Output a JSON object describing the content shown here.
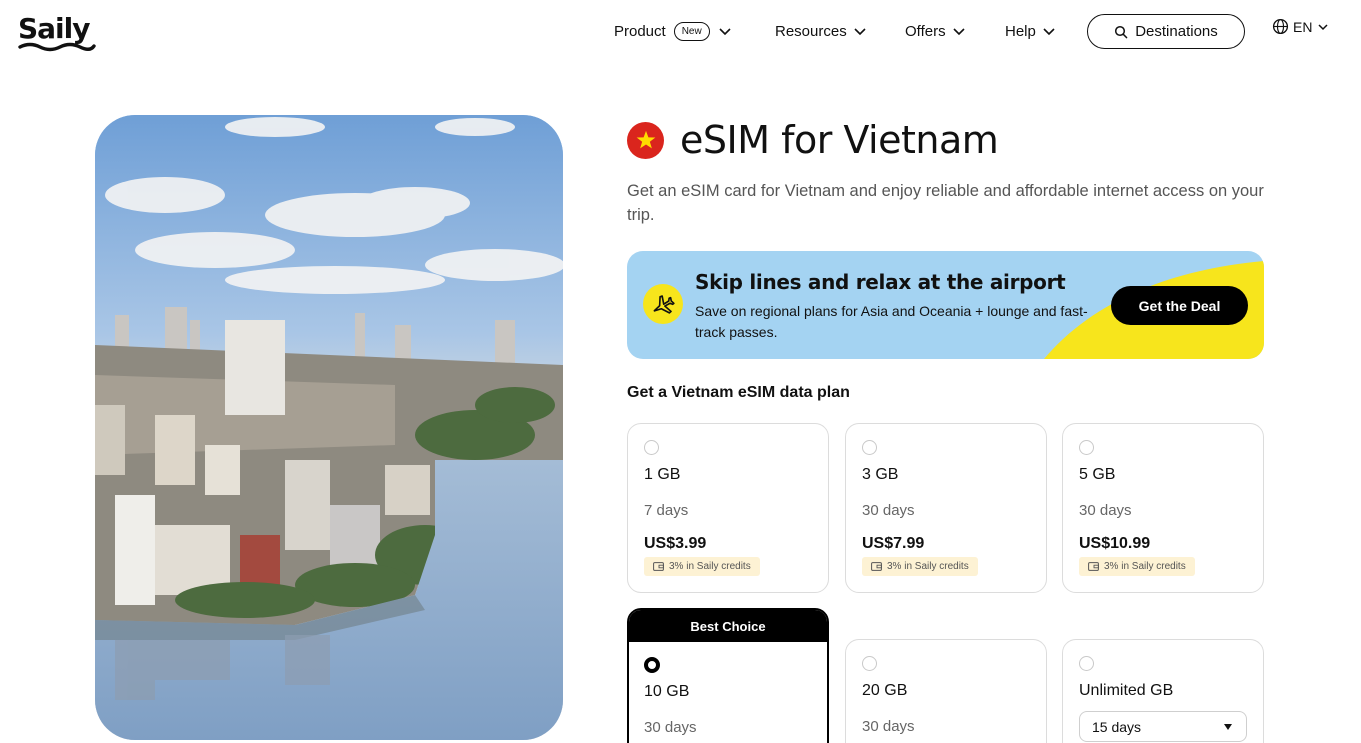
{
  "brand": {
    "logo_text": "Saily"
  },
  "nav": {
    "product": "Product",
    "product_badge": "New",
    "resources": "Resources",
    "offers": "Offers",
    "help": "Help",
    "destinations": "Destinations",
    "language": "EN"
  },
  "page": {
    "title": "eSIM for Vietnam",
    "subtitle": "Get an eSIM card for Vietnam and enjoy reliable and affordable internet access on your trip."
  },
  "promo": {
    "title": "Skip lines and relax at the airport",
    "text": "Save on regional plans for Asia and Oceania + lounge and fast-track passes.",
    "cta": "Get the Deal"
  },
  "plans": {
    "heading": "Get a Vietnam eSIM data plan",
    "items": [
      {
        "data": "1 GB",
        "duration": "7 days",
        "price": "US$3.99",
        "credit": "3% in Saily credits",
        "selected": false
      },
      {
        "data": "3 GB",
        "duration": "30 days",
        "price": "US$7.99",
        "credit": "3% in Saily credits",
        "selected": false
      },
      {
        "data": "5 GB",
        "duration": "30 days",
        "price": "US$10.99",
        "credit": "3% in Saily credits",
        "selected": false
      },
      {
        "badge": "Best Choice",
        "data": "10 GB",
        "duration": "30 days",
        "selected": true
      },
      {
        "data": "20 GB",
        "duration": "30 days",
        "selected": false
      },
      {
        "data": "Unlimited GB",
        "duration_select": "15 days",
        "selected": false
      }
    ]
  },
  "colors": {
    "promo_bg": "#a4d3f2",
    "promo_accent": "#f7e51c",
    "flag_red": "#da251d",
    "flag_star": "#ffdd00",
    "credit_bg": "#fdf2d4"
  },
  "icons": {
    "nav_chevron": "chevron-down-icon",
    "search": "search-icon",
    "language": "globe-icon",
    "promo": "airplane-icon",
    "credit": "wallet-icon",
    "select": "caret-down-icon"
  }
}
